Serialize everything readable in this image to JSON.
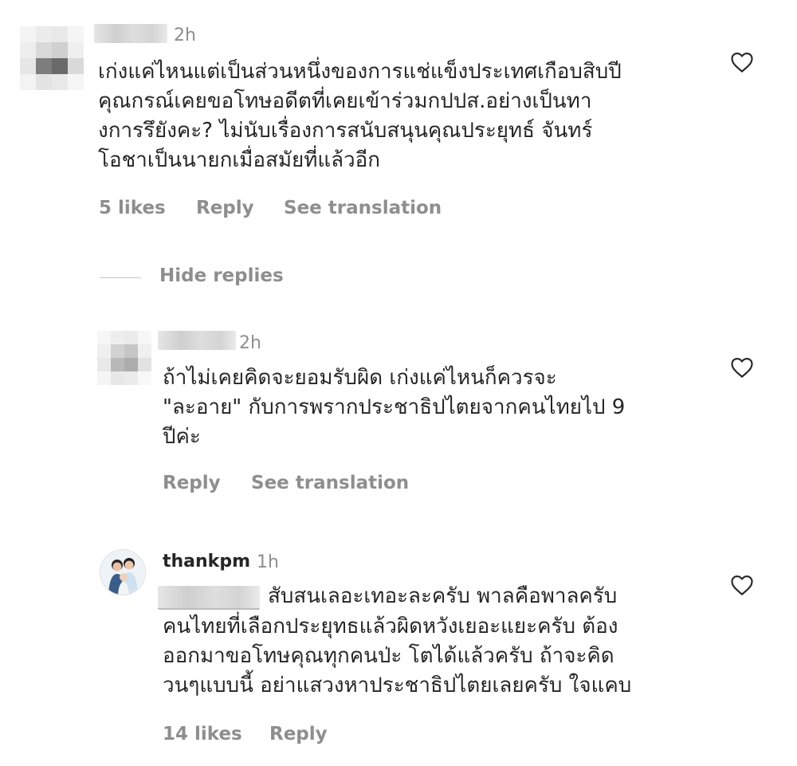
{
  "comments": [
    {
      "username": "",
      "time": "2h",
      "text": "เก่งแค่ไหนแต่เป็นส่วนหนึ่งของการแช่แข็งประเทศเกือบสิบปี\nคุณกรณ์เคยขอโทษอดีตที่เคยเข้าร่วมกปปส.อย่างเป็นทา\nงการรึยังคะ? ไม่นับเรื่องการสนับสนุนคุณประยุทธ์ จันทร์\nโอชาเป็นนายกเมื่อสมัยที่แล้วอีก",
      "likes": "5 likes",
      "reply": "Reply",
      "translate": "See translation"
    }
  ],
  "hide_replies": "Hide replies",
  "replies": [
    {
      "username": "",
      "time": "2h",
      "text": "ถ้าไม่เคยคิดจะยอมรับผิด เก่งแค่ไหนก็ควรจะ\n\"ละอาย\" กับการพรากประชาธิปไตยจากคนไทยไป 9\nปีค่ะ",
      "reply": "Reply",
      "translate": "See translation"
    },
    {
      "username": "thankpm",
      "time": "1h",
      "mention_hidden": true,
      "text_first": "สับสนเลอะเทอะละครับ พาลคือพาลครับ",
      "text_rest": "คนไทยที่เลือกประยุทธแล้วผิดหวังเยอะแยะครับ ต้อง\nออกมาขอโทษคุณทุกคนป่ะ โตได้แล้วครับ ถ้าจะคิด\nวนๆแบบนี้ อย่าแสวงหาประชาธิปไตยเลยครับ ใจแคบ",
      "likes": "14 likes",
      "reply": "Reply"
    }
  ],
  "colors": {
    "text": "#262626",
    "secondary": "#8e8e8e",
    "divider": "#c7c7c7"
  },
  "icons": {
    "like": "heart-outline-icon"
  }
}
